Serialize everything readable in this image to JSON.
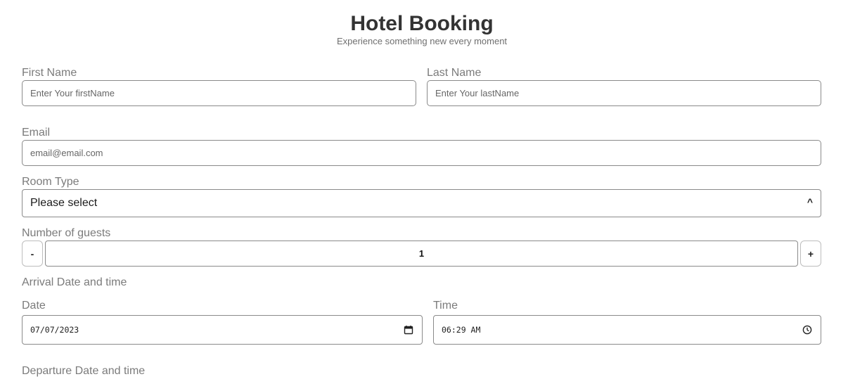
{
  "header": {
    "title": "Hotel Booking",
    "subtitle": "Experience something new every moment"
  },
  "form": {
    "first_name": {
      "label": "First Name",
      "placeholder": "Enter Your firstName"
    },
    "last_name": {
      "label": "Last Name",
      "placeholder": "Enter Your lastName"
    },
    "email": {
      "label": "Email",
      "placeholder": "email@email.com"
    },
    "room_type": {
      "label": "Room Type",
      "value": "Please select",
      "caret": "^"
    },
    "guests": {
      "label": "Number of guests",
      "minus": "-",
      "value": "1",
      "plus": "+"
    },
    "arrival": {
      "section_label": "Arrival Date and time",
      "date_label": "Date",
      "date_value": "07/07/2023",
      "time_label": "Time",
      "time_value": "06:29 AM"
    },
    "departure": {
      "section_label": "Departure Date and time"
    }
  },
  "icons": {
    "calendar": "calendar-icon",
    "clock": "clock-icon"
  }
}
